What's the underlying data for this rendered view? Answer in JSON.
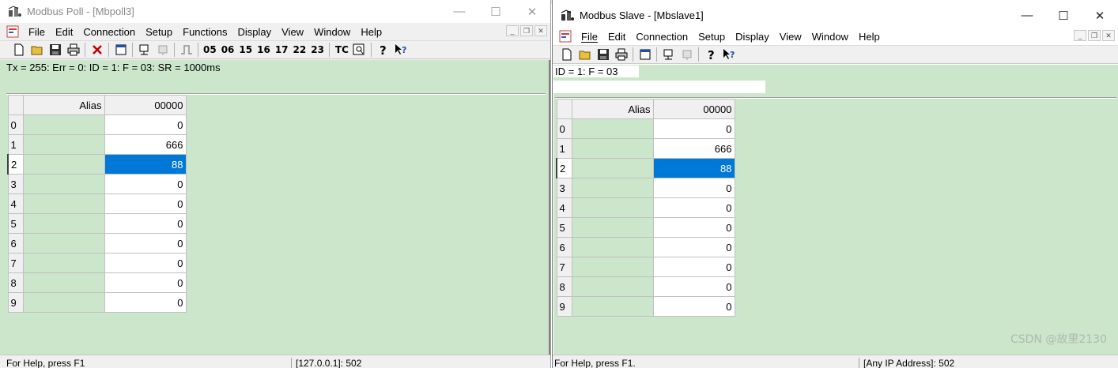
{
  "poll": {
    "title": "Modbus Poll - [Mbpoll3]",
    "caption": {
      "minimize": "—",
      "maximize": "☐",
      "close": "✕"
    },
    "menu": [
      "File",
      "Edit",
      "Connection",
      "Setup",
      "Functions",
      "Display",
      "View",
      "Window",
      "Help"
    ],
    "toolbar": {
      "function_codes": [
        "05",
        "06",
        "15",
        "16",
        "17",
        "22",
        "23"
      ],
      "tc_label": "TC"
    },
    "status_line": "Tx = 255: Err = 0: ID = 1: F = 03: SR = 1000ms",
    "grid": {
      "alias_header": "Alias",
      "address_header": "00000",
      "rows": [
        {
          "num": "0",
          "value": "0"
        },
        {
          "num": "1",
          "value": "666"
        },
        {
          "num": "2",
          "value": "88"
        },
        {
          "num": "3",
          "value": "0"
        },
        {
          "num": "4",
          "value": "0"
        },
        {
          "num": "5",
          "value": "0"
        },
        {
          "num": "6",
          "value": "0"
        },
        {
          "num": "7",
          "value": "0"
        },
        {
          "num": "8",
          "value": "0"
        },
        {
          "num": "9",
          "value": "0"
        }
      ],
      "selected_row": 2
    },
    "statusbar": {
      "help": "For Help, press F1",
      "address": "[127.0.0.1]: 502"
    }
  },
  "slave": {
    "title": "Modbus Slave - [Mbslave1]",
    "caption": {
      "minimize": "—",
      "maximize": "☐",
      "close": "✕"
    },
    "menu": [
      "File",
      "Edit",
      "Connection",
      "Setup",
      "Display",
      "View",
      "Window",
      "Help"
    ],
    "status_line": "ID = 1: F = 03",
    "grid": {
      "alias_header": "Alias",
      "address_header": "00000",
      "rows": [
        {
          "num": "0",
          "value": "0"
        },
        {
          "num": "1",
          "value": "666"
        },
        {
          "num": "2",
          "value": "88"
        },
        {
          "num": "3",
          "value": "0"
        },
        {
          "num": "4",
          "value": "0"
        },
        {
          "num": "5",
          "value": "0"
        },
        {
          "num": "6",
          "value": "0"
        },
        {
          "num": "7",
          "value": "0"
        },
        {
          "num": "8",
          "value": "0"
        },
        {
          "num": "9",
          "value": "0"
        }
      ],
      "selected_row": 2
    },
    "statusbar": {
      "help": "For Help, press F1.",
      "address": "[Any IP Address]: 502"
    }
  },
  "watermark": "CSDN @故里2130",
  "colors": {
    "client_bg": "#cce6cc",
    "selection": "#0078d7"
  }
}
